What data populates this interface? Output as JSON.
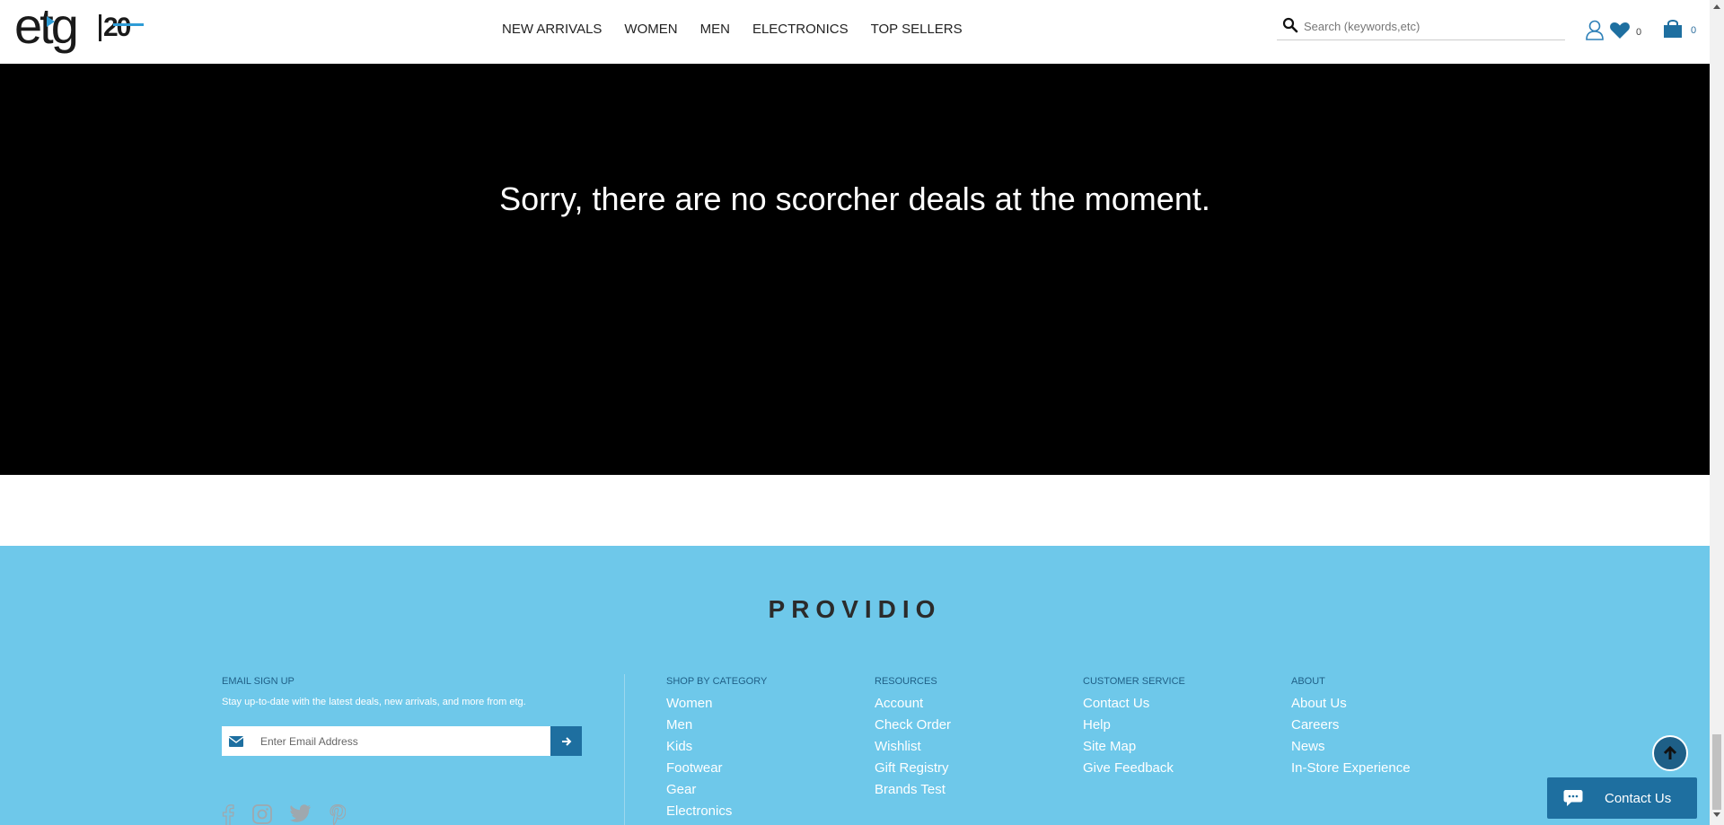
{
  "header": {
    "logo_text": "etg",
    "logo_badge": "20",
    "nav": [
      "NEW ARRIVALS",
      "WOMEN",
      "MEN",
      "ELECTRONICS",
      "TOP SELLERS"
    ],
    "search_placeholder": "Search (keywords,etc)",
    "wishlist_count": "0",
    "cart_count": "0"
  },
  "hero": {
    "message": "Sorry, there are no scorcher deals at the moment."
  },
  "footer": {
    "brand": "PROVIDIO",
    "signup": {
      "title": "EMAIL SIGN UP",
      "text": "Stay up-to-date with the latest deals, new arrivals, and more from etg.",
      "placeholder": "Enter Email Address"
    },
    "columns": [
      {
        "title": "SHOP BY CATEGORY",
        "links": [
          "Women",
          "Men",
          "Kids",
          "Footwear",
          "Gear",
          "Electronics"
        ]
      },
      {
        "title": "RESOURCES",
        "links": [
          "Account",
          "Check Order",
          "Wishlist",
          "Gift Registry",
          "Brands Test"
        ]
      },
      {
        "title": "CUSTOMER SERVICE",
        "links": [
          "Contact Us",
          "Help",
          "Site Map",
          "Give Feedback"
        ]
      },
      {
        "title": "ABOUT",
        "links": [
          "About Us",
          "Careers",
          "News",
          "In-Store Experience"
        ]
      }
    ],
    "social_icons": [
      "facebook-icon",
      "instagram-icon",
      "twitter-icon",
      "pinterest-icon"
    ],
    "contact_button": "Contact Us"
  },
  "colors": {
    "footer_bg": "#6ec8ea",
    "accent": "#1e6fa0",
    "hero_bg": "#000000"
  }
}
